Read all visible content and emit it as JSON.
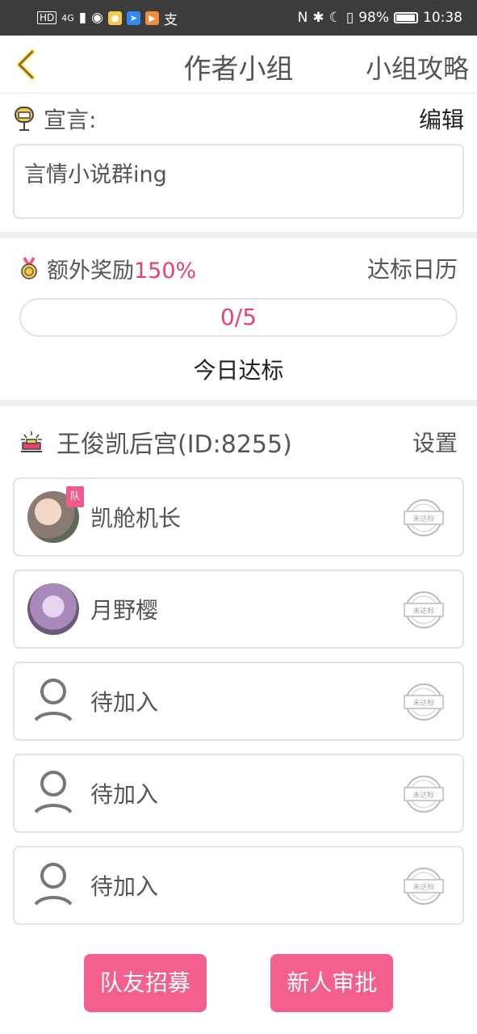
{
  "statusbar": {
    "battery": "98%",
    "time": "10:38",
    "signal_label": "HD",
    "network": "4G"
  },
  "header": {
    "title": "作者小组",
    "right_link": "小组攻略"
  },
  "manifesto": {
    "label": "宣言:",
    "edit": "编辑",
    "text": "言情小说群ing"
  },
  "bonus": {
    "label": "额外奖励",
    "percent": "150%",
    "calendar": "达标日历",
    "progress": "0/5",
    "today": "今日达标"
  },
  "team": {
    "name": "王俊凯后宫(ID:8255)",
    "settings": "设置"
  },
  "members": [
    {
      "name": "凯舱机长",
      "badge": "队",
      "stamp": "未达标"
    },
    {
      "name": "月野樱",
      "stamp": "未达标"
    },
    {
      "name": "待加入",
      "stamp": "未达标"
    },
    {
      "name": "待加入",
      "stamp": "未达标"
    },
    {
      "name": "待加入",
      "stamp": "未达标"
    }
  ],
  "actions": {
    "recruit": "队友招募",
    "approve": "新人审批"
  },
  "colors": {
    "accent": "#f45f8d",
    "highlight": "#e8446a",
    "statusbar": "#3c3c3c"
  }
}
